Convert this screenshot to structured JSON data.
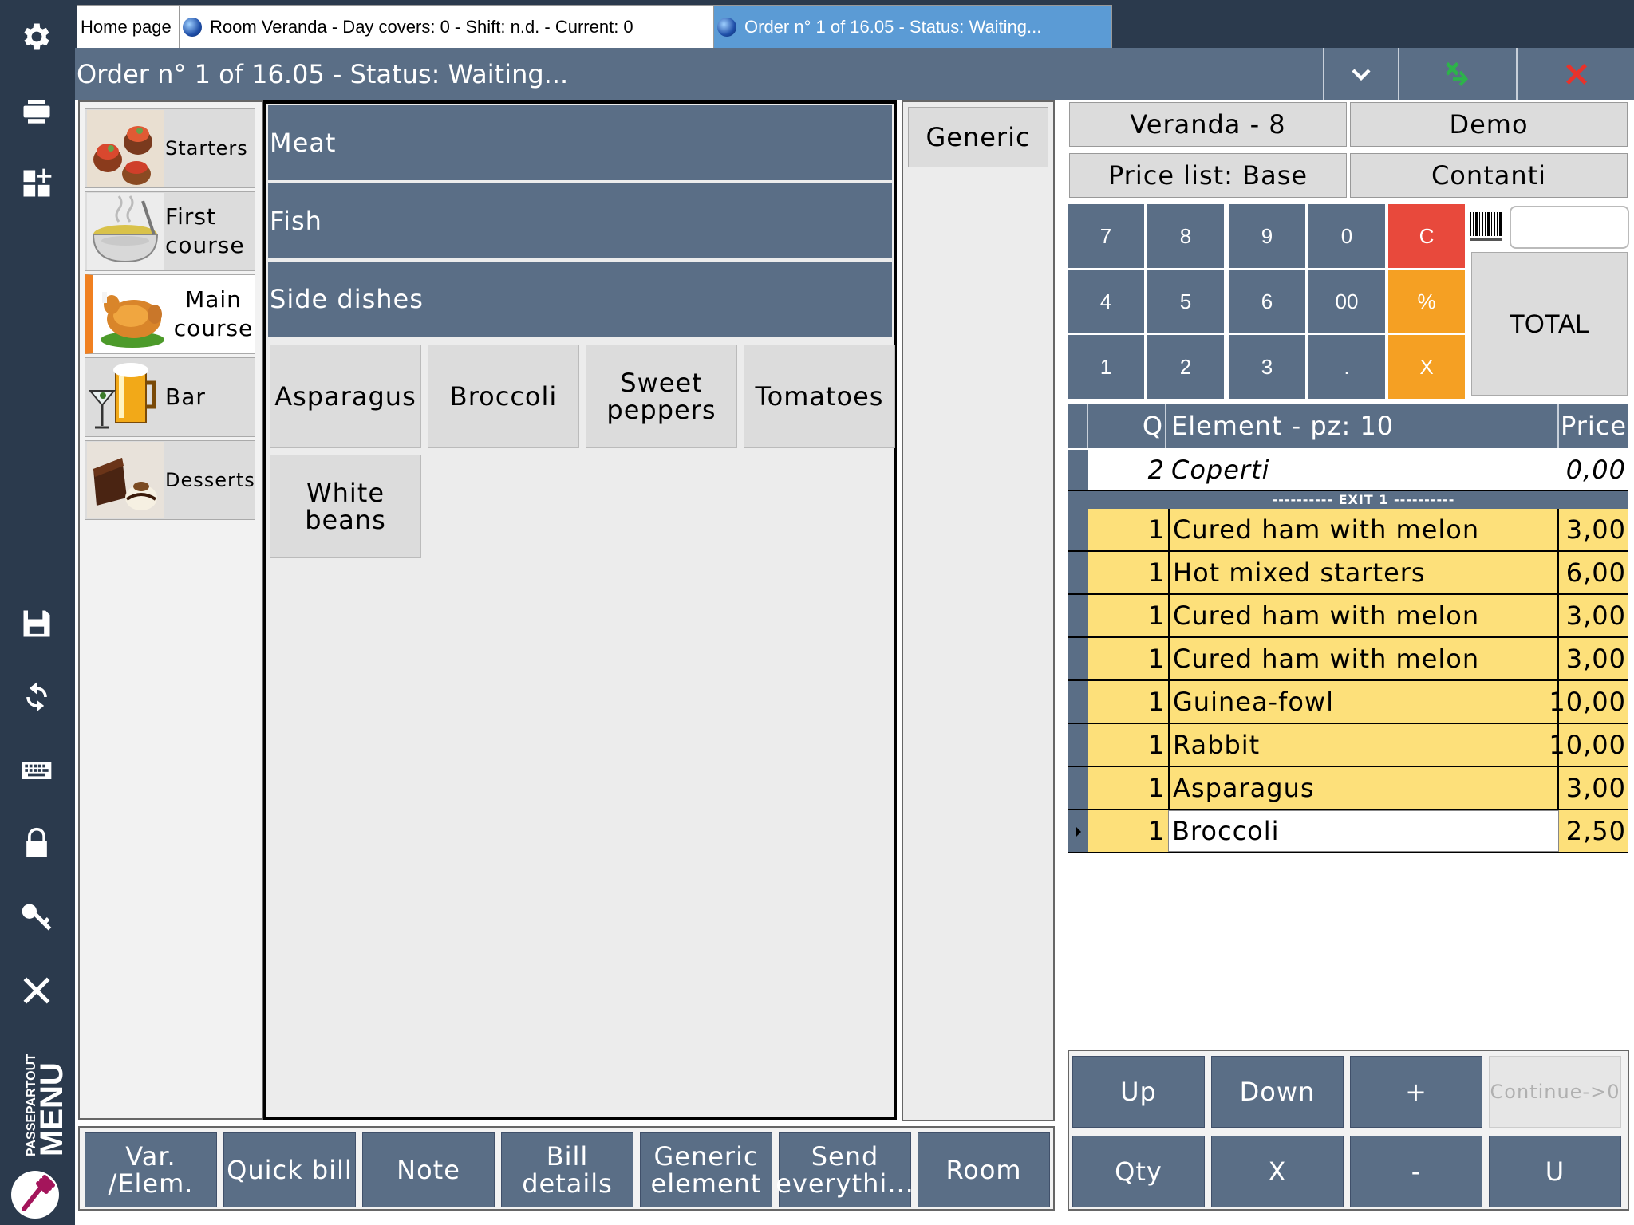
{
  "sidebar": {
    "icons": [
      "gear-icon",
      "printer-icon",
      "dashboard-add-icon",
      "save-icon",
      "refresh-icon",
      "keyboard-icon",
      "lock-icon",
      "key-icon",
      "close-icon"
    ],
    "logo_small": "PASSEPARTOUT",
    "logo_big": "MENU"
  },
  "tabs": [
    {
      "label": "Home page"
    },
    {
      "label": "Room Veranda - Day covers: 0 - Shift: n.d. - Current: 0"
    },
    {
      "label": "Order n° 1 of 16.05 - Status: Waiting..."
    }
  ],
  "header": {
    "title": "Order n° 1 of 16.05 - Status: Waiting...",
    "accent_green": "#2db34a",
    "accent_red": "#e8322b"
  },
  "categories": [
    {
      "label": "Starters",
      "icon": "starters-image"
    },
    {
      "label": "First course",
      "icon": "first-course-image"
    },
    {
      "label": "Main course",
      "icon": "main-course-image",
      "selected": true
    },
    {
      "label": "Bar",
      "icon": "bar-image"
    },
    {
      "label": "Desserts",
      "icon": "desserts-image"
    }
  ],
  "subcategories": [
    "Meat",
    "Fish",
    "Side dishes"
  ],
  "products": [
    "Asparagus",
    "Broccoli",
    "Sweet peppers",
    "Tomatoes",
    "White beans"
  ],
  "generic_label": "Generic",
  "info": {
    "table": "Veranda - 8",
    "operator": "Demo",
    "price_list": "Price list: Base",
    "payment": "Contanti"
  },
  "keypad": {
    "keys": [
      "7",
      "8",
      "9",
      "0",
      "C",
      "4",
      "5",
      "6",
      "00",
      "%",
      "1",
      "2",
      "3",
      ".",
      "X"
    ],
    "total_label": "TOTAL",
    "quantity_value": ""
  },
  "order": {
    "headers": {
      "q": "Q",
      "element": "Element - pz: 10",
      "price": "Price"
    },
    "covers": {
      "q": "2",
      "element": "Coperti",
      "price": "0,00"
    },
    "exit_label": "---------- EXIT 1 ----------",
    "items": [
      {
        "q": "1",
        "element": "Cured ham with melon",
        "price": "3,00"
      },
      {
        "q": "1",
        "element": "Hot mixed starters",
        "price": "6,00"
      },
      {
        "q": "1",
        "element": "Cured ham with melon",
        "price": "3,00"
      },
      {
        "q": "1",
        "element": "Cured ham with melon",
        "price": "3,00"
      },
      {
        "q": "1",
        "element": "Guinea-fowl",
        "price": "10,00"
      },
      {
        "q": "1",
        "element": "Rabbit",
        "price": "10,00"
      },
      {
        "q": "1",
        "element": "Asparagus",
        "price": "3,00"
      },
      {
        "q": "1",
        "element": "Broccoli",
        "price": "2,50"
      }
    ]
  },
  "actions": [
    "Var. /Elem.",
    "Quick bill",
    "Note",
    "Bill details",
    "Generic element",
    "Send everythi...",
    "Room"
  ],
  "nav": {
    "up": "Up",
    "down": "Down",
    "plus": "+",
    "continue": "Continue->0",
    "qty": "Qty",
    "x": "X",
    "minus": "-",
    "u": "U"
  }
}
